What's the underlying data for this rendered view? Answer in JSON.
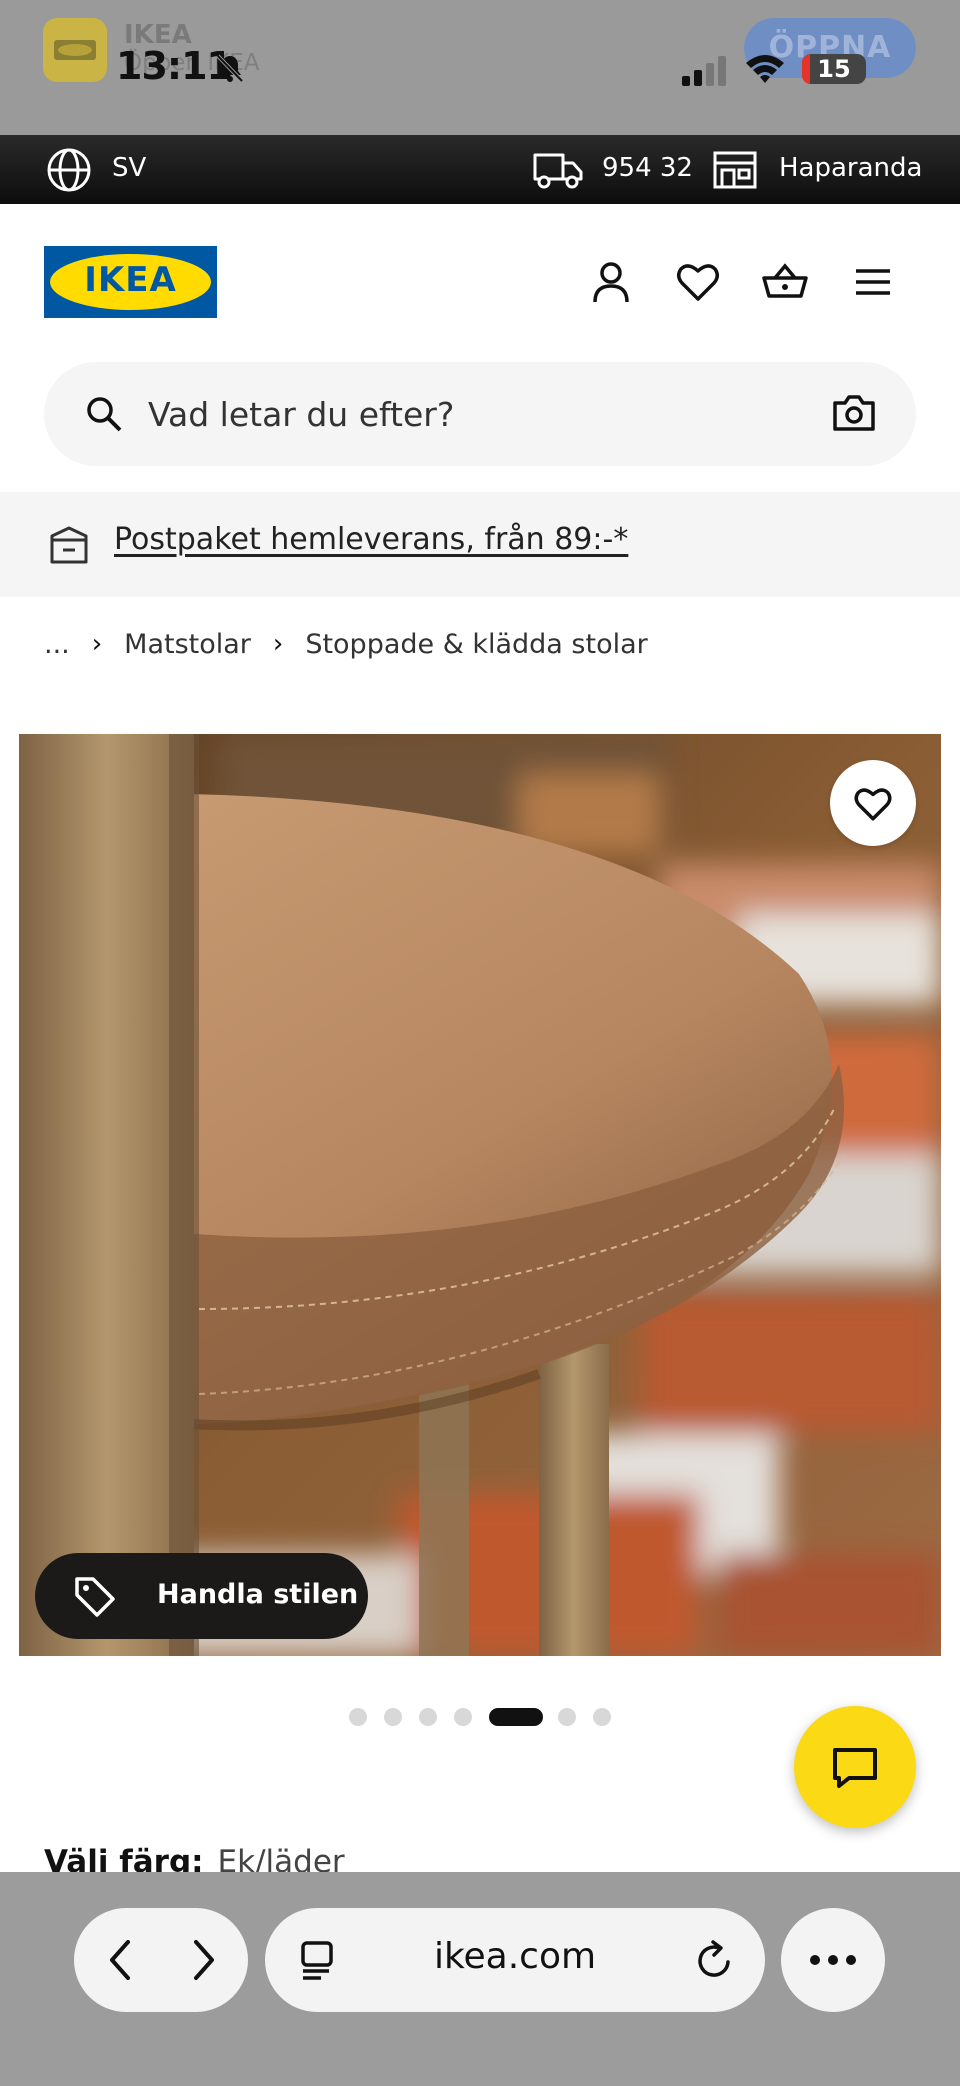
{
  "status_bar": {
    "time": "13:11",
    "battery": "15",
    "icons": [
      "bell-slash-icon",
      "cellular-signal-icon",
      "wifi-icon",
      "battery-icon"
    ]
  },
  "app_banner": {
    "name": "IKEA",
    "subtitle": "Öppen IKEA",
    "open_label": "ÖPPNA"
  },
  "top_strip": {
    "language": "SV",
    "zip": "954 32",
    "store": "Haparanda"
  },
  "header": {
    "logo_text": "IKEA",
    "colors": {
      "logo_blue": "#0058a3",
      "logo_yellow": "#ffdb00"
    }
  },
  "search": {
    "placeholder": "Vad letar du efter?"
  },
  "delivery": {
    "text": "Postpaket hemleverans, från 89:-*"
  },
  "breadcrumb": {
    "items": [
      "...",
      "Matstolar",
      "Stoppade & klädda stolar"
    ]
  },
  "product": {
    "shop_style_label": "Handla stilen",
    "image_count": 7,
    "active_image": 5,
    "color_label": "Välj färg:",
    "color_value": "Ek/läder"
  },
  "chat": {
    "color": "#fbd914"
  },
  "browser": {
    "url": "ikea.com"
  }
}
